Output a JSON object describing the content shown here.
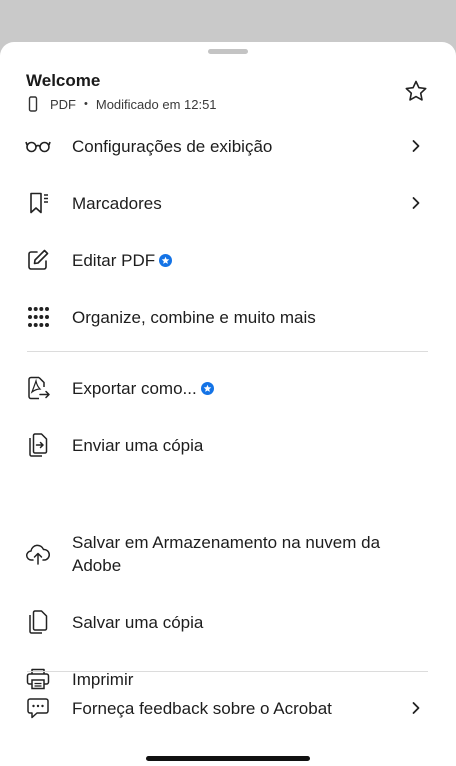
{
  "document": {
    "title": "Welcome",
    "type": "PDF",
    "separator": "•",
    "modified": "Modificado em 12:51"
  },
  "menu": {
    "view_settings": "Configurações de exibição",
    "bookmarks": "Marcadores",
    "edit_pdf": "Editar PDF",
    "organize": "Organize, combine e muito mais",
    "export": "Exportar como...",
    "send_copy": "Enviar uma cópia",
    "save_cloud": "Salvar em Armazenamento na nuvem da Adobe",
    "save_copy": "Salvar uma cópia",
    "print": "Imprimir",
    "feedback": "Forneça feedback sobre o Acrobat"
  },
  "colors": {
    "accent": "#1473e6",
    "backdrop": "#c9c9c9"
  },
  "icons": [
    "device-phone-icon",
    "star-icon",
    "glasses-icon",
    "bookmark-icon",
    "edit-icon",
    "grid-icon",
    "export-icon",
    "send-copy-icon",
    "cloud-upload-icon",
    "copy-icon",
    "printer-icon",
    "feedback-icon",
    "chevron-right-icon",
    "premium-badge-icon"
  ]
}
